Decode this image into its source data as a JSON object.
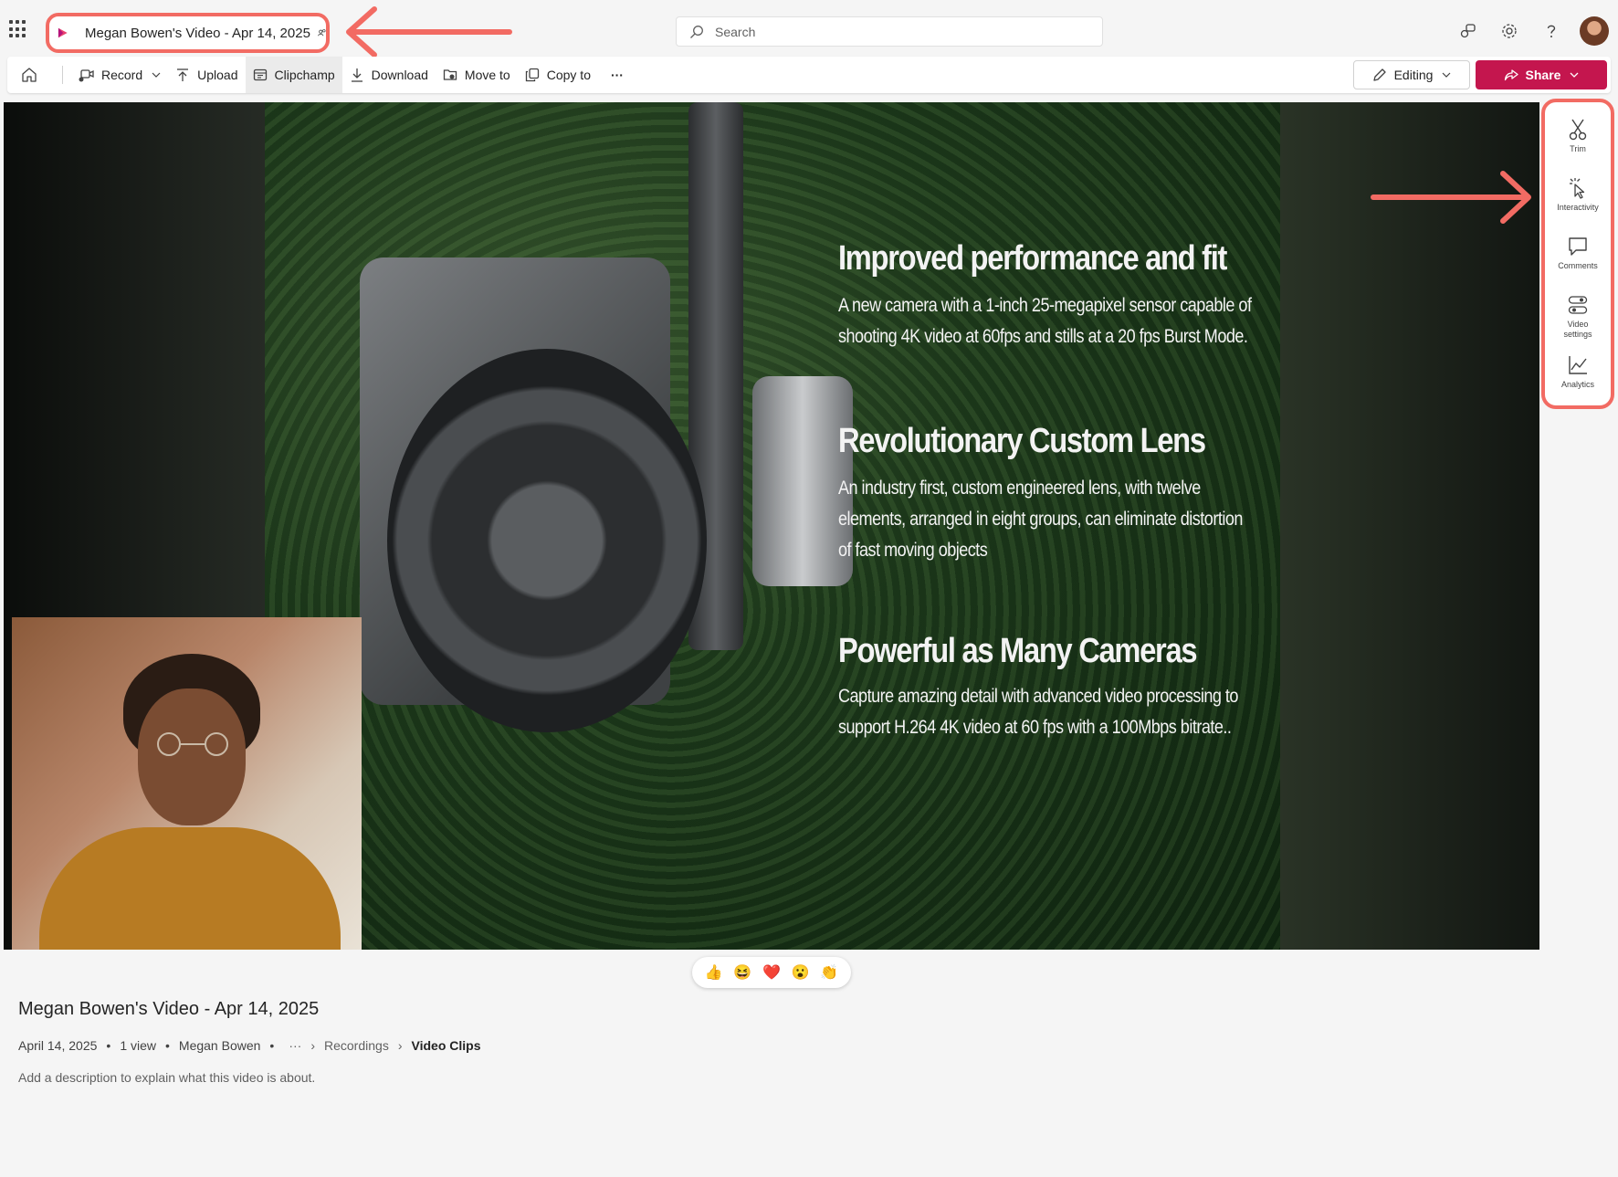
{
  "app": {
    "video_title": "Megan Bowen's Video - Apr 14, 2025"
  },
  "search": {
    "placeholder": "Search"
  },
  "commandbar": {
    "record": "Record",
    "upload": "Upload",
    "clipchamp": "Clipchamp",
    "download": "Download",
    "move_to": "Move to",
    "copy_to": "Copy to",
    "more": "···",
    "editing": "Editing",
    "share": "Share"
  },
  "slide": {
    "heading1": "Improved performance and fit",
    "body1": "A new camera with a 1-inch 25-megapixel sensor capable of shooting 4K video at 60fps and stills at a 20 fps Burst Mode.",
    "heading2": "Revolutionary Custom Lens",
    "body2": "An industry first, custom engineered lens, with twelve elements, arranged in eight groups, can eliminate distortion of fast moving objects",
    "heading3": "Powerful as Many Cameras",
    "body3": "Capture amazing detail with advanced video processing to support H.264 4K video at 60 fps with a 100Mbps bitrate.."
  },
  "reactions": [
    "👍",
    "😆",
    "❤️",
    "😮",
    "👏"
  ],
  "details": {
    "title": "Megan Bowen's Video - Apr 14, 2025",
    "date": "April 14, 2025",
    "views": "1 view",
    "owner": "Megan Bowen",
    "breadcrumb_more": "···",
    "breadcrumb": [
      "Recordings",
      "Video Clips"
    ],
    "description_placeholder": "Add a description to explain what this video is about."
  },
  "side_panel": {
    "items": [
      {
        "label": "Trim",
        "icon": "scissors-icon"
      },
      {
        "label": "Interactivity",
        "icon": "cursor-click-icon"
      },
      {
        "label": "Comments",
        "icon": "comment-icon"
      },
      {
        "label": "Video settings",
        "icon": "settings-toggles-icon"
      },
      {
        "label": "Analytics",
        "icon": "line-chart-icon"
      }
    ]
  },
  "colors": {
    "accent_share": "#c4164e",
    "callout": "#f26b63"
  }
}
